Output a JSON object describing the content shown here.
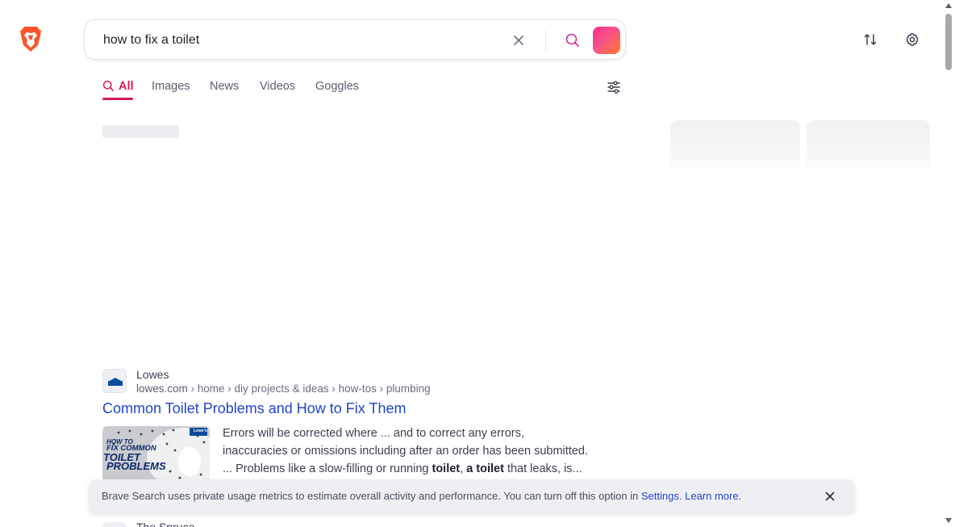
{
  "search": {
    "query": "how to fix a toilet",
    "clear_icon": "close-icon",
    "search_icon": "search-icon",
    "leo_icon": "leo-ai-icon"
  },
  "header": {
    "logo": "brave-lion-logo",
    "sort_icon": "swap-icon",
    "settings_icon": "gear-icon"
  },
  "tabs": [
    {
      "label": "All",
      "active": true
    },
    {
      "label": "Images",
      "active": false
    },
    {
      "label": "News",
      "active": false
    },
    {
      "label": "Videos",
      "active": false
    },
    {
      "label": "Goggles",
      "active": false
    }
  ],
  "result": {
    "site_name": "Lowes",
    "domain": "lowes.com",
    "path": " › home › diy projects & ideas › how-tos › plumbing",
    "title": "Common Toilet Problems and How to Fix Them",
    "snippet_1": "Errors will be corrected where ... and to correct any errors,",
    "snippet_2": "inaccuracies or omissions including after an order has been submitted.",
    "snippet_3a": "... Problems like a slow-filling or running ",
    "snippet_bold_1": "toilet",
    "snippet_3b": ", ",
    "snippet_bold_2": "a toilet",
    "snippet_3c": " that leaks, is...",
    "thumb_line_1": "HOW TO",
    "thumb_line_2": "FIX COMMON",
    "thumb_line_3": "TOILET",
    "thumb_line_4": "PROBLEMS",
    "thumb_brand": "Lowe's"
  },
  "next_result": {
    "site_name": "The Spruce"
  },
  "banner": {
    "text": "Brave Search uses private usage metrics to estimate overall activity and performance. You can turn off this option in ",
    "settings_link": "Settings",
    "separator": ". ",
    "learn_more_link": "Learn more.",
    "close_icon": "close-icon"
  },
  "colors": {
    "accent": "#d8175a",
    "link": "#2146c7",
    "text": "#3b3e4f"
  }
}
